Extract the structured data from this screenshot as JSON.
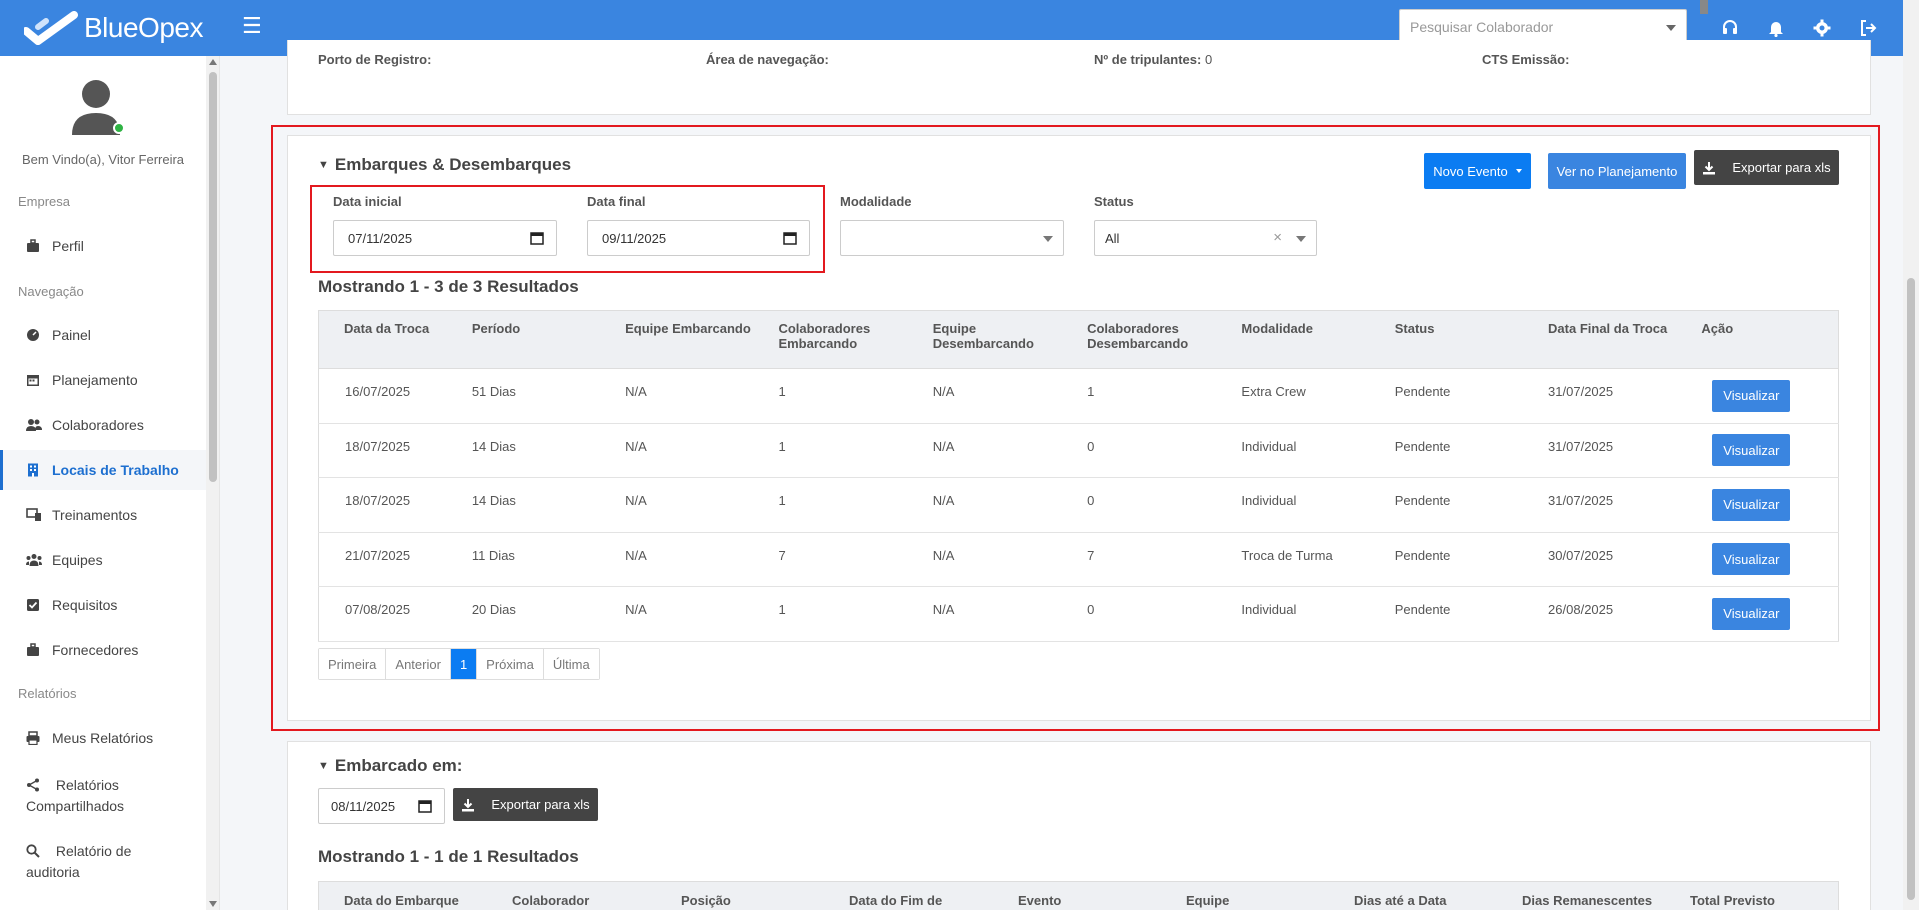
{
  "app": {
    "name": "BlueOpex"
  },
  "topbar": {
    "search_placeholder": "Pesquisar Colaborador",
    "icons": [
      "headset-icon",
      "bell-icon",
      "gear-icon",
      "logout-icon"
    ]
  },
  "sidebar": {
    "welcome": "Bem Vindo(a), Vitor Ferreira",
    "sections": {
      "empresa": "Empresa",
      "navegacao": "Navegação",
      "relatorios": "Relatórios"
    },
    "items": {
      "perfil": "Perfil",
      "painel": "Painel",
      "planejamento": "Planejamento",
      "colaboradores": "Colaboradores",
      "locais": "Locais de Trabalho",
      "treinamentos": "Treinamentos",
      "equipes": "Equipes",
      "requisitos": "Requisitos",
      "fornecedores": "Fornecedores",
      "meus_relatorios": "Meus Relatórios",
      "relatorios_compartilhados_1": "Relatórios",
      "relatorios_compartilhados_2": "Compartilhados",
      "relatorio_auditoria_1": "Relatório de",
      "relatorio_auditoria_2": "auditoria"
    },
    "active_item": "Locais de Trabalho"
  },
  "vessel_info": {
    "porto_label": "Porto de Registro:",
    "porto_value": "",
    "area_label": "Área de navegação:",
    "area_value": "",
    "tripulantes_label": "Nº de tripulantes:",
    "tripulantes_value": "0",
    "cts_label": "CTS Emissão:",
    "cts_value": ""
  },
  "embarques": {
    "title": "Embarques & Desembarques",
    "buttons": {
      "novo_evento": "Novo Evento",
      "ver_planejamento": "Ver no Planejamento",
      "exportar": "Exportar para xls"
    },
    "filters": {
      "data_inicial_label": "Data inicial",
      "data_inicial_value": "07/11/2025",
      "data_final_label": "Data final",
      "data_final_value": "09/11/2025",
      "modalidade_label": "Modalidade",
      "modalidade_value": "",
      "status_label": "Status",
      "status_value": "All"
    },
    "results": "Mostrando 1 - 3 de 3 Resultados",
    "columns": {
      "c0": "Data da Troca",
      "c1": "Período",
      "c2": "Equipe Embarcando",
      "c3a": "Colaboradores",
      "c3b": "Embarcando",
      "c4a": "Equipe",
      "c4b": "Desembarcando",
      "c5a": "Colaboradores",
      "c5b": "Desembarcando",
      "c6": "Modalidade",
      "c7": "Status",
      "c8": "Data Final da Troca",
      "c9": "Ação"
    },
    "rows": [
      {
        "data": "16/07/2025",
        "periodo": "51 Dias",
        "equipe_emb": "N/A",
        "colab_emb": "1",
        "equipe_des": "N/A",
        "colab_des": "1",
        "modalidade": "Extra Crew",
        "status": "Pendente",
        "data_final": "31/07/2025",
        "acao": "Visualizar"
      },
      {
        "data": "18/07/2025",
        "periodo": "14 Dias",
        "equipe_emb": "N/A",
        "colab_emb": "1",
        "equipe_des": "N/A",
        "colab_des": "0",
        "modalidade": "Individual",
        "status": "Pendente",
        "data_final": "31/07/2025",
        "acao": "Visualizar"
      },
      {
        "data": "18/07/2025",
        "periodo": "14 Dias",
        "equipe_emb": "N/A",
        "colab_emb": "1",
        "equipe_des": "N/A",
        "colab_des": "0",
        "modalidade": "Individual",
        "status": "Pendente",
        "data_final": "31/07/2025",
        "acao": "Visualizar"
      },
      {
        "data": "21/07/2025",
        "periodo": "11 Dias",
        "equipe_emb": "N/A",
        "colab_emb": "7",
        "equipe_des": "N/A",
        "colab_des": "7",
        "modalidade": "Troca de Turma",
        "status": "Pendente",
        "data_final": "30/07/2025",
        "acao": "Visualizar"
      },
      {
        "data": "07/08/2025",
        "periodo": "20 Dias",
        "equipe_emb": "N/A",
        "colab_emb": "1",
        "equipe_des": "N/A",
        "colab_des": "0",
        "modalidade": "Individual",
        "status": "Pendente",
        "data_final": "26/08/2025",
        "acao": "Visualizar"
      }
    ],
    "pager": {
      "first": "Primeira",
      "prev": "Anterior",
      "current": "1",
      "next": "Próxima",
      "last": "Última"
    }
  },
  "embarcado": {
    "title": "Embarcado em:",
    "date_value": "08/11/2025",
    "export": "Exportar para xls",
    "results": "Mostrando 1 - 1 de 1 Resultados",
    "columns": {
      "c0": "Data do Embarque",
      "c1": "Colaborador",
      "c2": "Posição",
      "c3": "Data do Fim de",
      "c4": "Evento",
      "c5": "Equipe",
      "c6": "Dias até a Data",
      "c7": "Dias Remanescentes",
      "c8": "Total Previsto"
    }
  }
}
